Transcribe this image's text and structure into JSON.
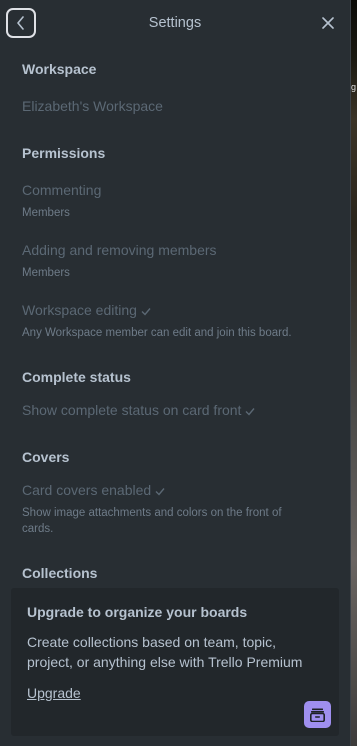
{
  "header": {
    "title": "Settings"
  },
  "workspace": {
    "heading": "Workspace",
    "name": "Elizabeth's Workspace"
  },
  "permissions": {
    "heading": "Permissions",
    "commenting": {
      "label": "Commenting",
      "value": "Members"
    },
    "members": {
      "label": "Adding and removing members",
      "value": "Members"
    },
    "editing": {
      "label": "Workspace editing",
      "value": "Any Workspace member can edit and join this board."
    }
  },
  "complete_status": {
    "heading": "Complete status",
    "label": "Show complete status on card front"
  },
  "covers": {
    "heading": "Covers",
    "label": "Card covers enabled",
    "description_line1": "Show image attachments and colors on the front of",
    "description_line2": "cards."
  },
  "collections": {
    "heading": "Collections"
  },
  "upgrade_card": {
    "heading": "Upgrade to organize your boards",
    "description": "Create collections based on team, topic, project, or anything else with Trello Premium",
    "link": "Upgrade"
  },
  "background_glint": "g",
  "colors": {
    "panel_bg": "#282e33",
    "card_bg": "#22272b",
    "text_primary": "#b6c2cf",
    "text_muted": "#5b6874",
    "premium_accent": "#9f8fef"
  }
}
